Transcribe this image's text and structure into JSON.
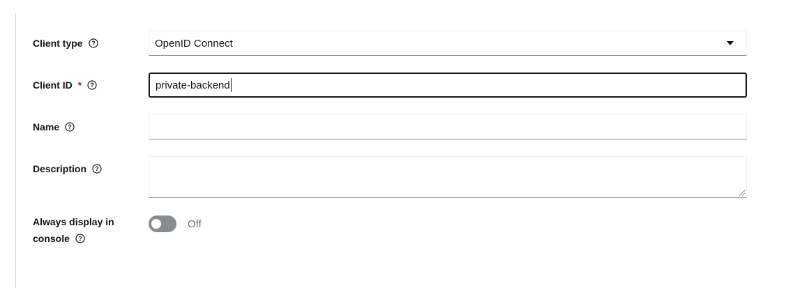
{
  "form": {
    "client_type": {
      "label": "Client type",
      "value": "OpenID Connect",
      "help_icon": "help-circle-icon",
      "caret_icon": "caret-down-icon"
    },
    "client_id": {
      "label": "Client ID",
      "required_marker": "*",
      "value": "private-backend",
      "help_icon": "help-circle-icon"
    },
    "name": {
      "label": "Name",
      "value": "",
      "help_icon": "help-circle-icon"
    },
    "description": {
      "label": "Description",
      "value": "",
      "help_icon": "help-circle-icon"
    },
    "always_display": {
      "label_line1": "Always display in",
      "label_line2": "console",
      "state_text": "Off",
      "checked": false,
      "help_icon": "help-circle-icon"
    }
  },
  "colors": {
    "required": "#c9190b",
    "toggle_off": "#8a8d90",
    "focus_border": "#151515"
  }
}
